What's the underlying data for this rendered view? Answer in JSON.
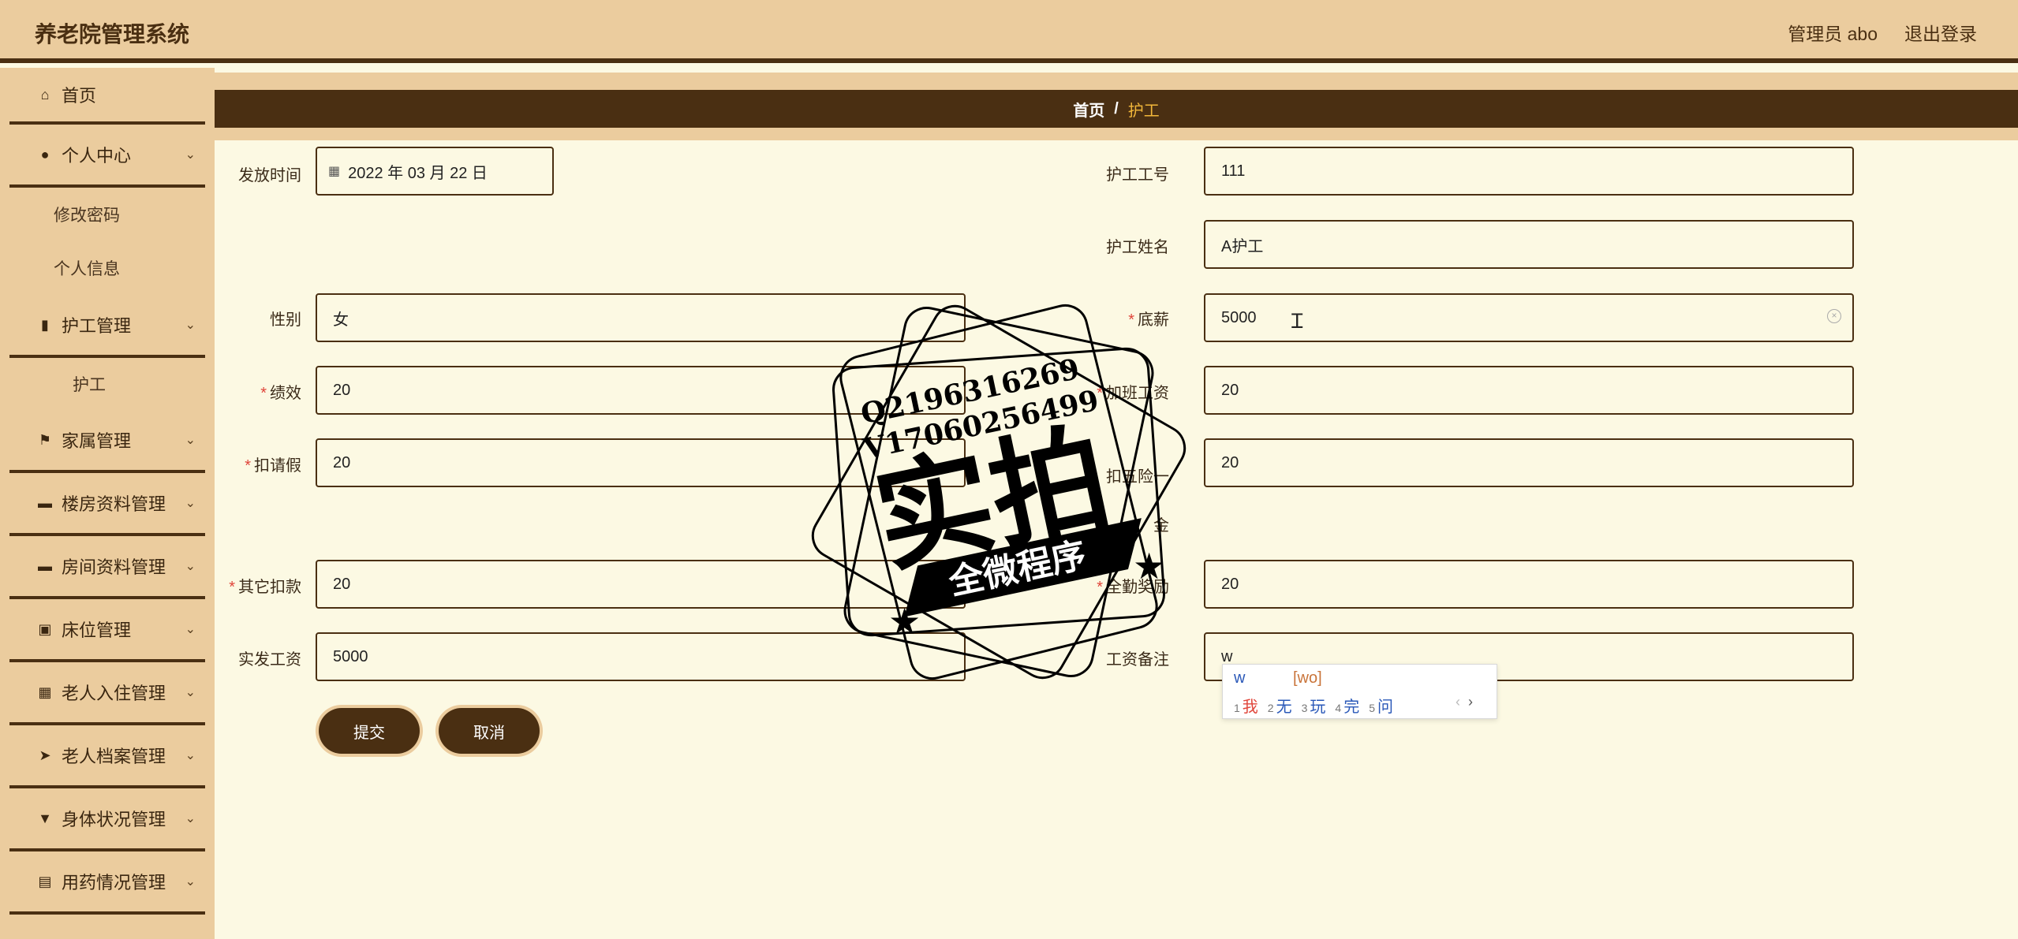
{
  "app": {
    "title": "养老院管理系统"
  },
  "header": {
    "admin_label": "管理员 abo",
    "logout_label": "退出登录"
  },
  "sidebar": {
    "home": "首页",
    "personal": "个人中心",
    "personal_sub": [
      "修改密码",
      "个人信息"
    ],
    "nurse_mgmt": "护工管理",
    "nurse_sub": "护工",
    "items": [
      "家属管理",
      "楼房资料管理",
      "房间资料管理",
      "床位管理",
      "老人入住管理",
      "老人档案管理",
      "身体状况管理",
      "用药情况管理"
    ]
  },
  "breadcrumb": {
    "home": "首页",
    "separator": "/",
    "current": "护工"
  },
  "form": {
    "issue_date": {
      "label": "发放时间",
      "value": "2022 年 03 月 22 日"
    },
    "nurse_id": {
      "label": "护工工号",
      "value": "111"
    },
    "nurse_name": {
      "label": "护工姓名",
      "value": "A护工"
    },
    "gender": {
      "label": "性别",
      "value": "女"
    },
    "base_salary": {
      "label": "底薪",
      "value": "5000"
    },
    "performance": {
      "label": "绩效",
      "value": "20"
    },
    "overtime_pay": {
      "label": "加班工资",
      "value": "20"
    },
    "leave_deduct": {
      "label": "扣请假",
      "value": "20"
    },
    "insurance_deduct": {
      "label_line1": "扣五险一",
      "label_line2": "金",
      "value": "20"
    },
    "other_deduct": {
      "label": "其它扣款",
      "value": "20"
    },
    "full_attendance": {
      "label": "全勤奖励",
      "value": "20"
    },
    "net_salary": {
      "label": "实发工资",
      "value": "5000"
    },
    "salary_note": {
      "label": "工资备注",
      "value": "w"
    },
    "submit_label": "提交",
    "cancel_label": "取消"
  },
  "ime": {
    "input": "w",
    "pinyin": "[wo]",
    "candidates": [
      {
        "n": "1",
        "w": "我"
      },
      {
        "n": "2",
        "w": "无"
      },
      {
        "n": "3",
        "w": "玩"
      },
      {
        "n": "4",
        "w": "完"
      },
      {
        "n": "5",
        "w": "问"
      }
    ],
    "prev": "‹",
    "next": "›"
  },
  "watermark": {
    "line1": "Q2196316269",
    "line2": "V17060256499",
    "big": "实拍",
    "ribbon": "全微程序"
  },
  "colors": {
    "accent": "#4a2f12",
    "sidebar_bg": "#ebcc9e",
    "content_bg": "#fcf9e3",
    "breadcrumb_current": "#f2b73a",
    "required": "#e0453a"
  }
}
